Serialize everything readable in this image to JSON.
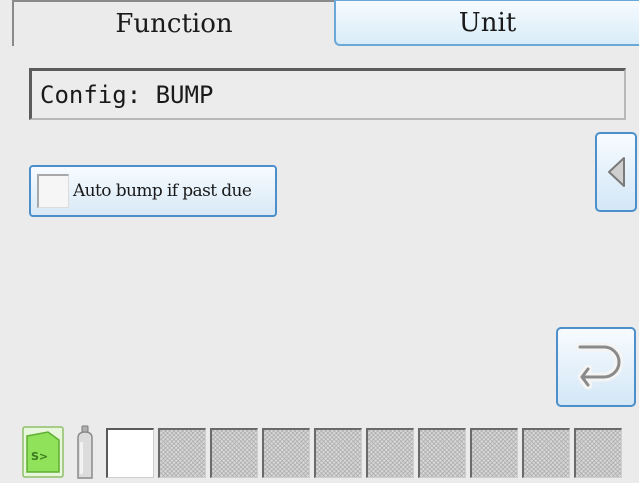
{
  "tabs": [
    {
      "label": "Function",
      "active": true
    },
    {
      "label": "Unit",
      "active": false
    }
  ],
  "config": {
    "text": "Config: BUMP"
  },
  "auto_bump": {
    "label": "Auto bump if past due",
    "checked": false
  },
  "buttons": {
    "back_icon": "triangle-left-icon",
    "return_icon": "return-arrow-icon"
  },
  "status_bar": {
    "sd_card_icon": "sd-card-icon",
    "bottle_icon": "gas-cylinder-icon",
    "slots": [
      "empty",
      "disabled",
      "disabled",
      "disabled",
      "disabled",
      "disabled",
      "disabled",
      "disabled",
      "disabled",
      "disabled"
    ]
  },
  "colors": {
    "accent_border": "#4c8fca",
    "button_gradient_top": "#f7fbff",
    "button_gradient_bottom": "#d3e7f6",
    "sd_icon_green": "#8fe25a",
    "background": "#ebebeb"
  }
}
